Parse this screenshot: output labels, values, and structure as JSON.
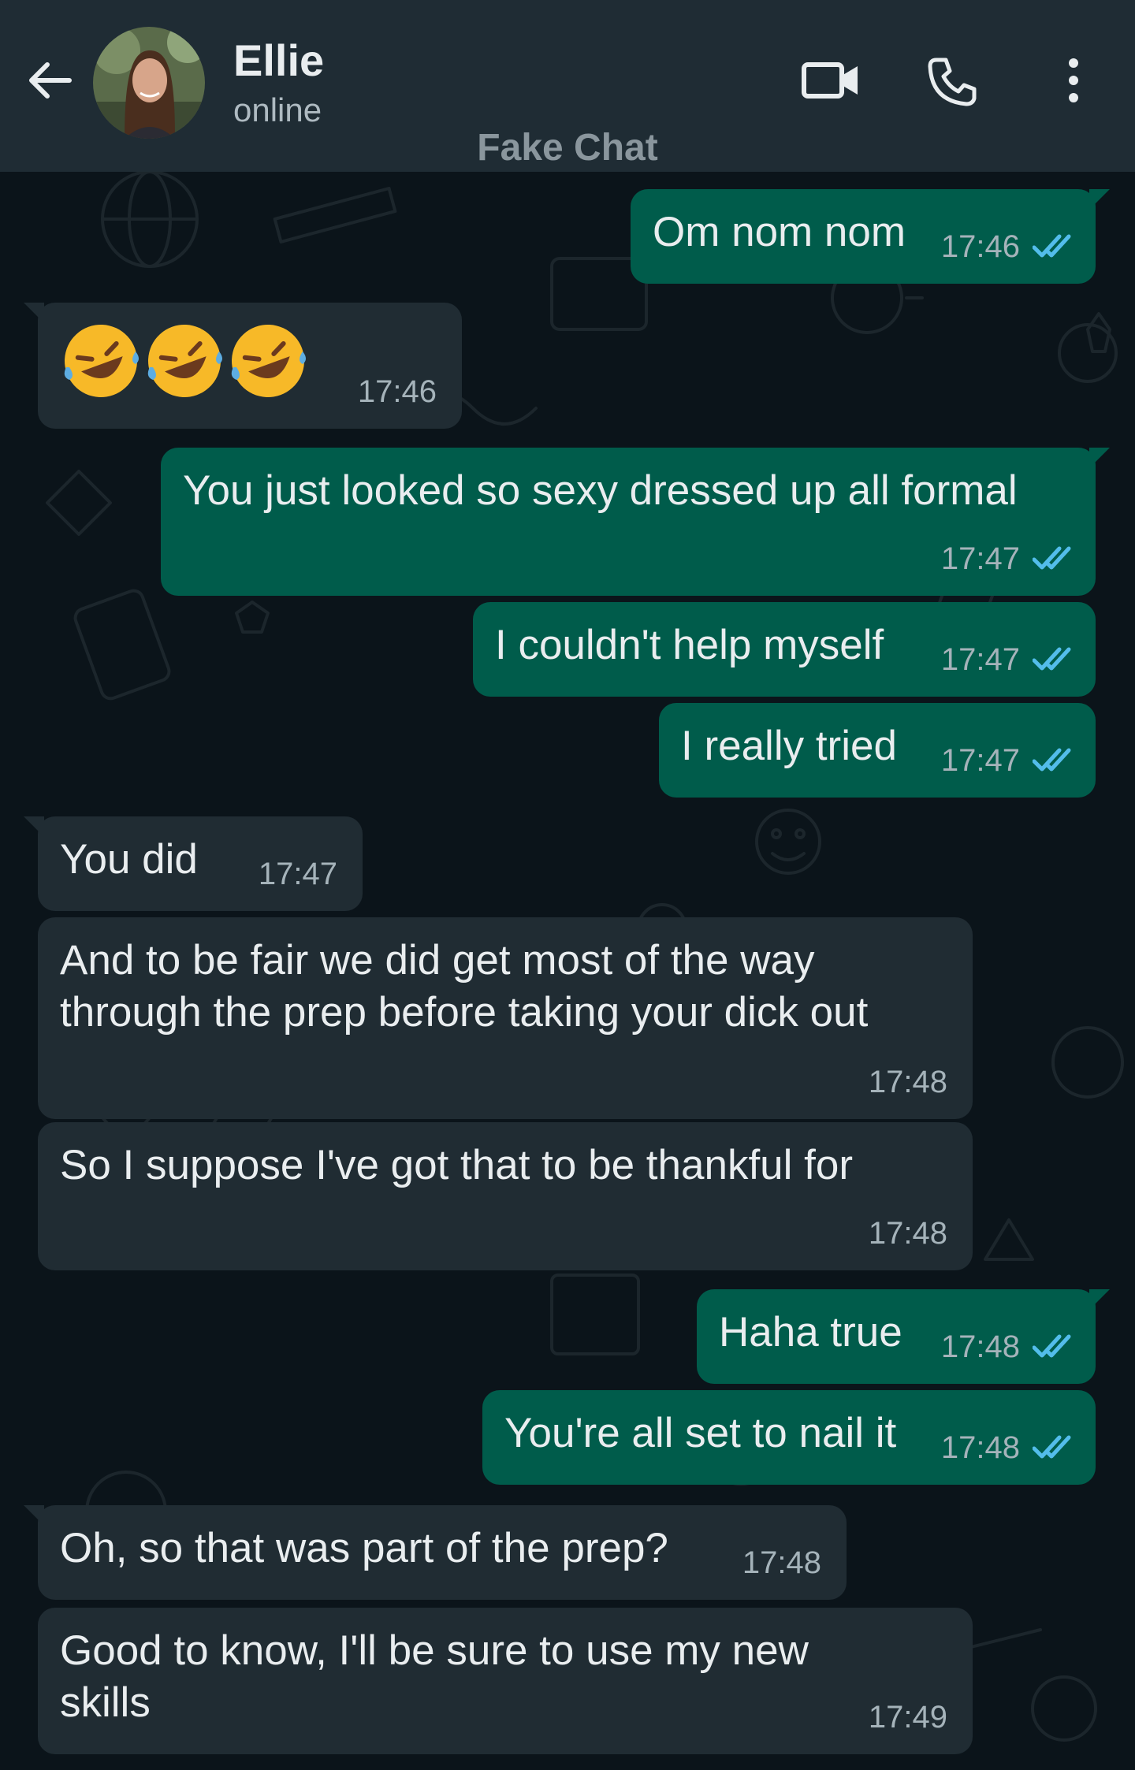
{
  "header": {
    "contact_name": "Ellie",
    "status": "online",
    "watermark": "Fake Chat"
  },
  "colors": {
    "header_bg": "#1f2c34",
    "chat_bg": "#0b141a",
    "incoming_bubble": "#202c33",
    "outgoing_bubble": "#005c4b",
    "read_tick": "#53bdeb"
  },
  "icons": [
    "back-arrow-icon",
    "video-call-icon",
    "voice-call-icon",
    "more-options-icon",
    "double-check-icon"
  ],
  "messages": [
    {
      "dir": "out",
      "text": "Om nom nom",
      "time": "17:46",
      "read": true
    },
    {
      "dir": "in",
      "text": "🤣🤣🤣",
      "time": "17:46"
    },
    {
      "dir": "out",
      "text": "You just looked so sexy dressed up all formal",
      "time": "17:47",
      "read": true
    },
    {
      "dir": "out",
      "text": "I couldn't help myself",
      "time": "17:47",
      "read": true
    },
    {
      "dir": "out",
      "text": "I really tried",
      "time": "17:47",
      "read": true
    },
    {
      "dir": "in",
      "text": "You did",
      "time": "17:47"
    },
    {
      "dir": "in",
      "text": "And to be fair we did get most of the way\nthrough the prep before taking your dick out",
      "time": "17:48"
    },
    {
      "dir": "in",
      "text": "So I suppose I've got that to be thankful for",
      "time": "17:48"
    },
    {
      "dir": "out",
      "text": "Haha true",
      "time": "17:48",
      "read": true
    },
    {
      "dir": "out",
      "text": "You're all set to nail it",
      "time": "17:48",
      "read": true
    },
    {
      "dir": "in",
      "text": "Oh, so that was part of the prep?",
      "time": "17:48"
    },
    {
      "dir": "in",
      "text": "Good to know, I'll be sure to use my new\nskills",
      "time": "17:49"
    }
  ]
}
